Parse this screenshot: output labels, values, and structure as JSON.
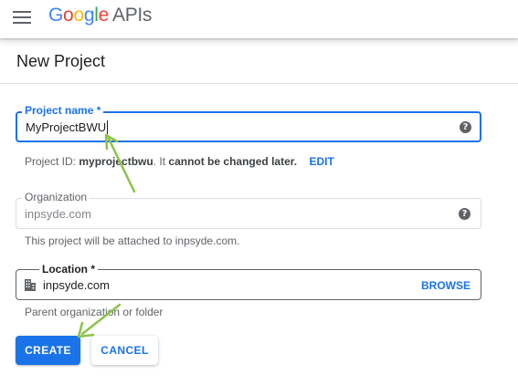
{
  "topbar": {
    "logo_letters": [
      {
        "char": "G",
        "color": "#4285F4"
      },
      {
        "char": "o",
        "color": "#EA4335"
      },
      {
        "char": "o",
        "color": "#FBBC05"
      },
      {
        "char": "g",
        "color": "#4285F4"
      },
      {
        "char": "l",
        "color": "#34A853"
      },
      {
        "char": "e",
        "color": "#EA4335"
      }
    ],
    "product_name": "APIs"
  },
  "page": {
    "title": "New Project"
  },
  "project_name": {
    "label": "Project name *",
    "value": "MyProjectBWU",
    "id_prefix": "Project ID: ",
    "id_value": "myprojectbwu",
    "id_middle": ". It ",
    "id_bold_note": "cannot be changed later.",
    "edit_label": "EDIT",
    "help_icon": "help-circle-icon"
  },
  "organization": {
    "label": "Organization",
    "value": "inpsyde.com",
    "hint": "This project will be attached to inpsyde.com.",
    "help_icon": "help-circle-icon"
  },
  "location": {
    "label": "Location *",
    "value": "inpsyde.com",
    "browse_label": "BROWSE",
    "hint": "Parent organization or folder",
    "icon": "organization-building-icon"
  },
  "actions": {
    "create_label": "CREATE",
    "cancel_label": "CANCEL"
  },
  "colors": {
    "accent": "#1a73e8",
    "annotation_arrow": "#8bc34a"
  }
}
